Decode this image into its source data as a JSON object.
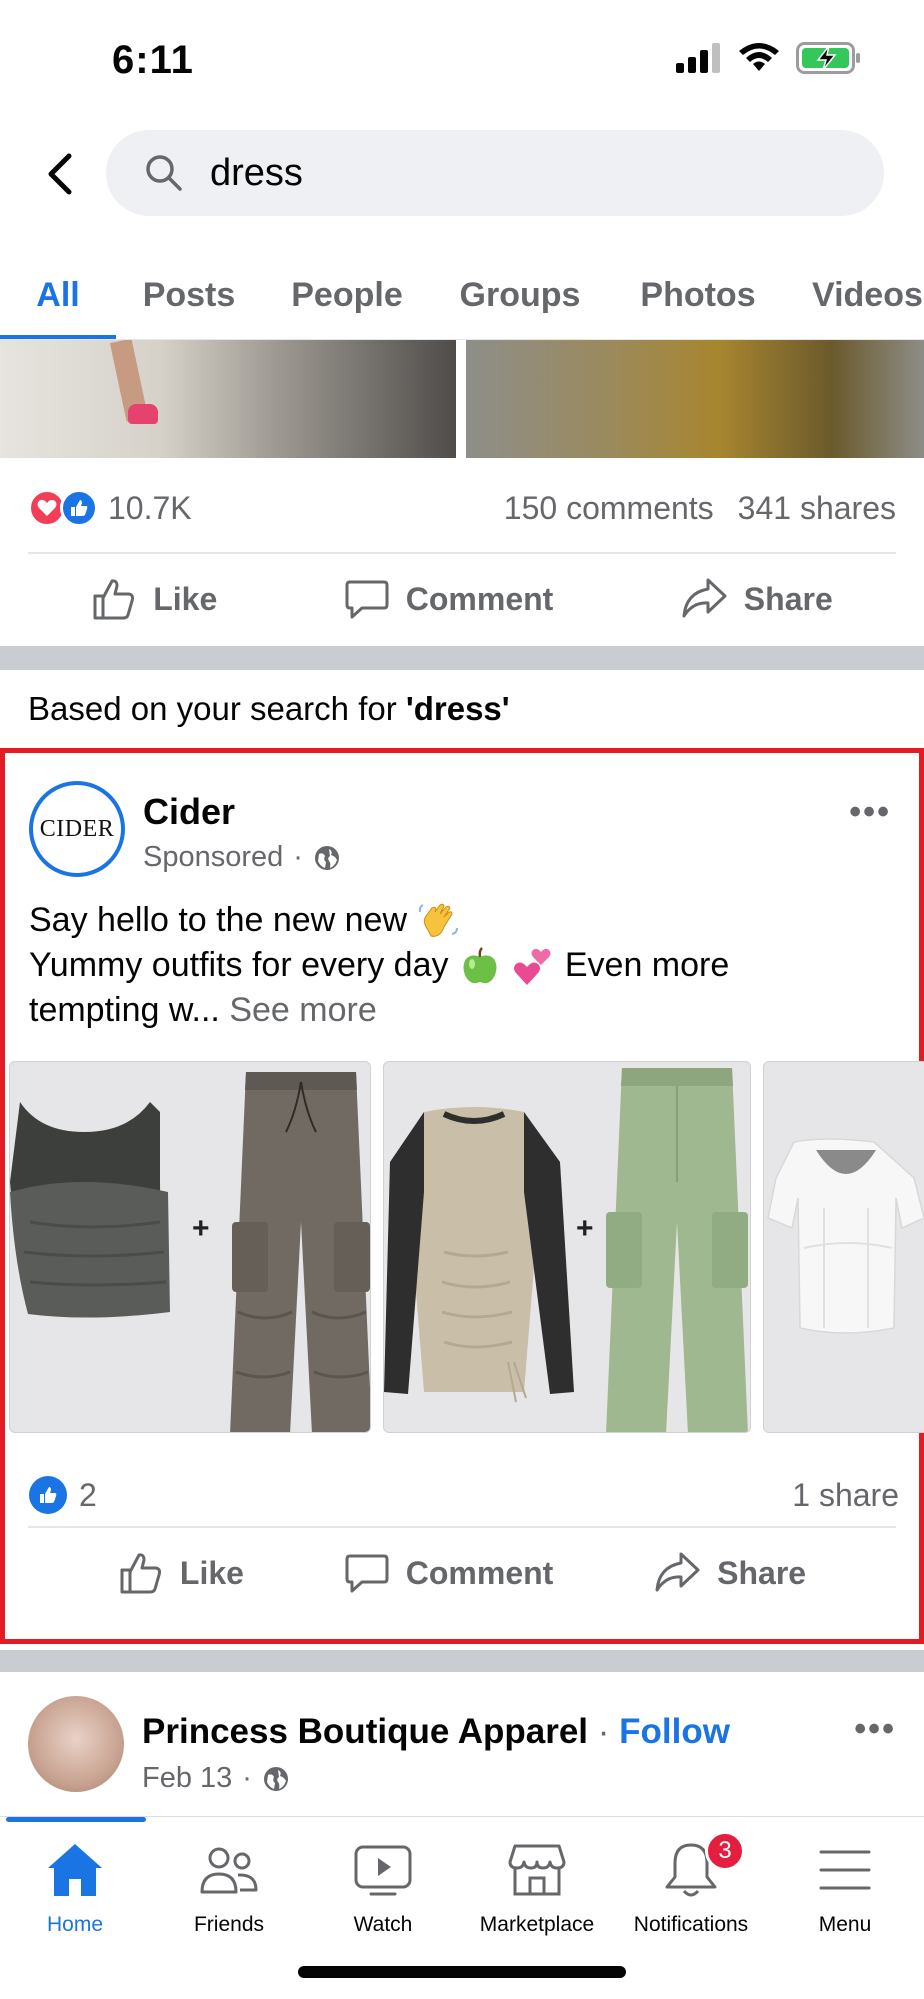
{
  "status_bar": {
    "time": "6:11"
  },
  "search": {
    "query": "dress"
  },
  "tabs": [
    "All",
    "Posts",
    "People",
    "Groups",
    "Photos",
    "Videos"
  ],
  "top_post": {
    "reaction_count": "10.7K",
    "comments": "150 comments",
    "shares": "341 shares"
  },
  "actions": {
    "like": "Like",
    "comment": "Comment",
    "share": "Share"
  },
  "section": {
    "label_prefix": "Based on your search for ",
    "label_query": "'dress'"
  },
  "ad": {
    "avatar_text": "CIDER",
    "name": "Cider",
    "sponsored": "Sponsored",
    "line1": "Say hello to the new new",
    "line2": "Yummy outfits for every day",
    "line2b": "Even more",
    "line3": "tempting w...",
    "see_more": "See more",
    "reaction_count": "2",
    "shares": "1 share"
  },
  "next_post": {
    "name": "Princess Boutique Apparel",
    "follow": "Follow",
    "date": "Feb 13"
  },
  "bottom_nav": {
    "home": "Home",
    "friends": "Friends",
    "watch": "Watch",
    "marketplace": "Marketplace",
    "notifications": "Notifications",
    "notifications_badge": "3",
    "menu": "Menu"
  },
  "colors": {
    "accent": "#1b74e4",
    "highlight_border": "#e31b23",
    "badge": "#e41e3f"
  }
}
